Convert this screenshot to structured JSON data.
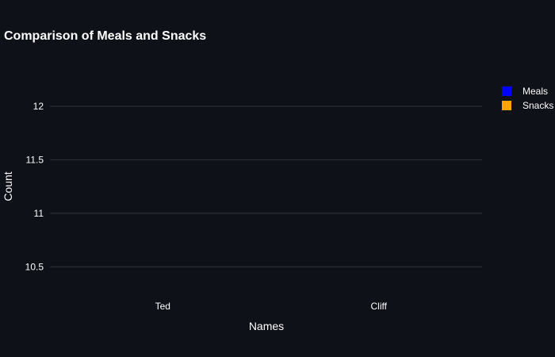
{
  "chart_data": {
    "type": "bar",
    "title": "Comparison of Meals and Snacks",
    "xlabel": "Names",
    "ylabel": "Count",
    "categories": [
      "Ted",
      "Cliff"
    ],
    "series": [
      {
        "name": "Meals",
        "values": [
          null,
          null
        ]
      },
      {
        "name": "Snacks",
        "values": [
          null,
          null
        ]
      }
    ],
    "ylim": [
      10.25,
      12.4
    ],
    "yticks": [
      10.5,
      11,
      11.5,
      12
    ],
    "ytick_labels": [
      "10.5",
      "11",
      "11.5",
      "12"
    ],
    "grid": true,
    "legend_position": "top-right"
  },
  "colors": {
    "background": "#0e1117",
    "gridline": "#2e323c",
    "text": "#ffffff",
    "meals": "#0000ff",
    "snacks": "#ffa500"
  }
}
